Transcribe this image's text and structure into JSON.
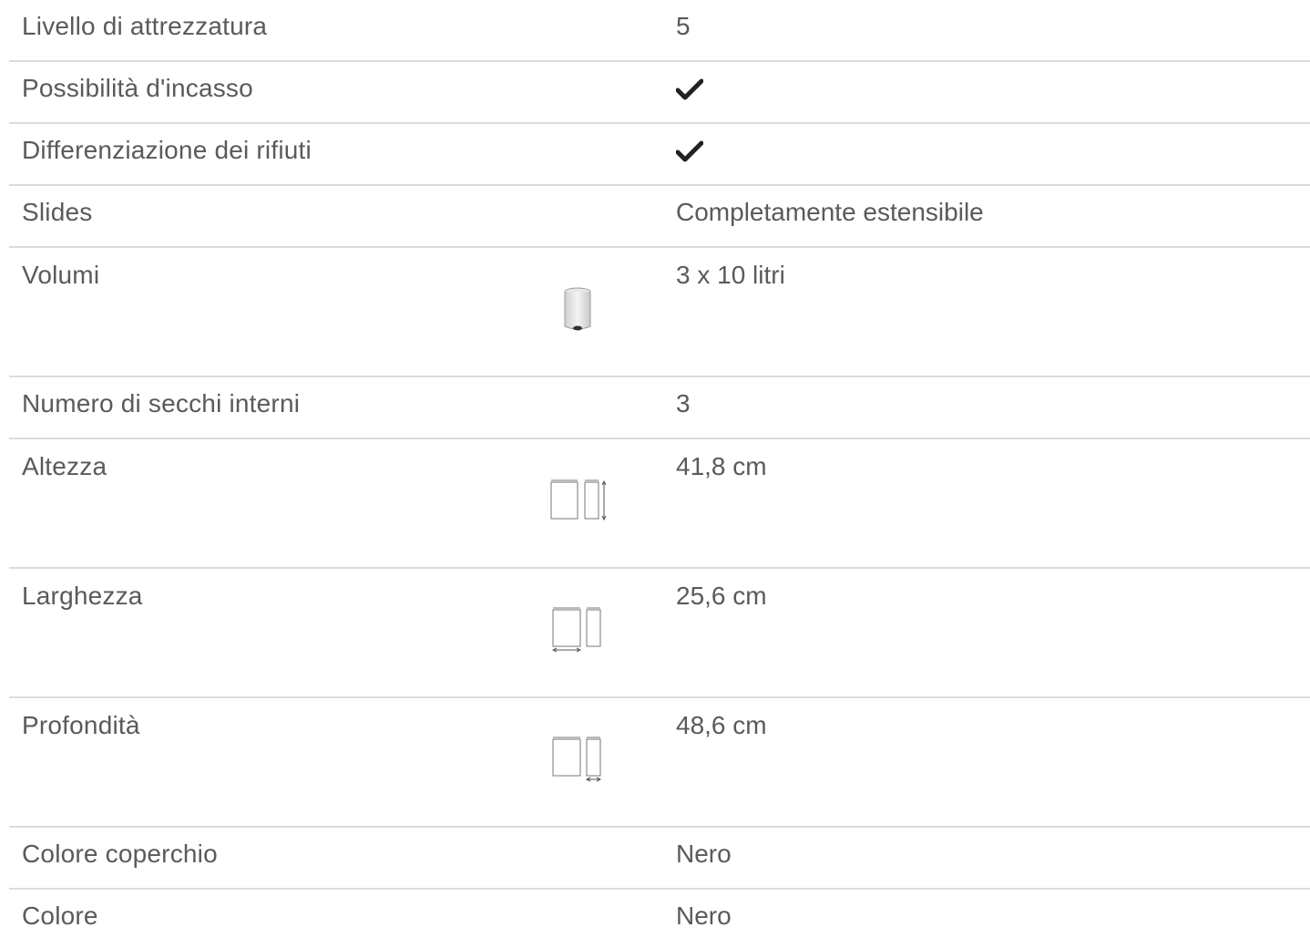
{
  "specs": [
    {
      "label": "Livello di attrezzatura",
      "value": "5"
    },
    {
      "label": "Possibilità d'incasso",
      "value_icon": "checkmark-icon"
    },
    {
      "label": "Differenziazione dei rifiuti",
      "value_icon": "checkmark-icon"
    },
    {
      "label": "Slides",
      "value": "Completamente estensibile"
    },
    {
      "label": "Volumi",
      "value": "3 x 10 litri",
      "icon": "bin-volume-icon"
    },
    {
      "label": "Numero di secchi interni",
      "value": "3"
    },
    {
      "label": "Altezza",
      "value": "41,8 cm",
      "icon": "height-dimension-icon"
    },
    {
      "label": "Larghezza",
      "value": "25,6 cm",
      "icon": "width-dimension-icon"
    },
    {
      "label": "Profondità",
      "value": "48,6 cm",
      "icon": "depth-dimension-icon"
    },
    {
      "label": "Colore coperchio",
      "value": "Nero"
    },
    {
      "label": "Colore",
      "value": "Nero"
    }
  ],
  "colors": {
    "text": "#5a5a5a",
    "divider": "#dcdcdc",
    "check": "#222222"
  }
}
